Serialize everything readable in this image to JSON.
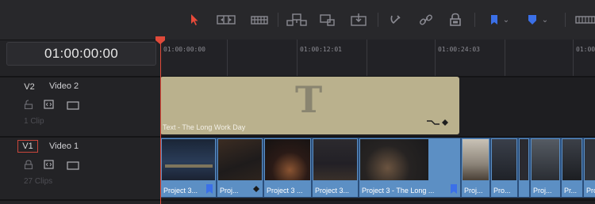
{
  "toolbar": {
    "icons": [
      "select-arrow-icon",
      "trim-icon",
      "dynamic-trim-icon",
      "insert-clip-icon",
      "overwrite-clip-icon",
      "replace-clip-icon",
      "snapping-icon",
      "linked-selection-icon",
      "position-lock-icon",
      "flag-icon",
      "marker-icon",
      "zoom-icon"
    ],
    "accent": "#e84a3a",
    "flag_color": "#3b70e8"
  },
  "timecode": "01:00:00:00",
  "ruler": {
    "labels": [
      "01:00:00:00",
      "01:00:12:01",
      "01:00:24:03",
      "01:00"
    ]
  },
  "tracks": [
    {
      "tag": "V2",
      "name": "Video 2",
      "count": "1 Clip"
    },
    {
      "tag": "V1",
      "name": "Video 1",
      "count": "27 Clips"
    }
  ],
  "title_clip": {
    "label": "Text - The Long Work Day",
    "glyph": "T"
  },
  "video_clips": [
    "Project 3...",
    "Proj...",
    "Project 3 ...",
    "Project 3...",
    "Project 3 - The Long ...",
    "Proj...",
    "Pro...",
    "",
    "Proj...",
    "Pr...",
    "Pro..."
  ],
  "colors": {
    "playhead": "#e04a3a",
    "clip_blue": "#5c8fc4",
    "title_clip": "#bab18d",
    "v1_tag_border": "#c9463b"
  }
}
